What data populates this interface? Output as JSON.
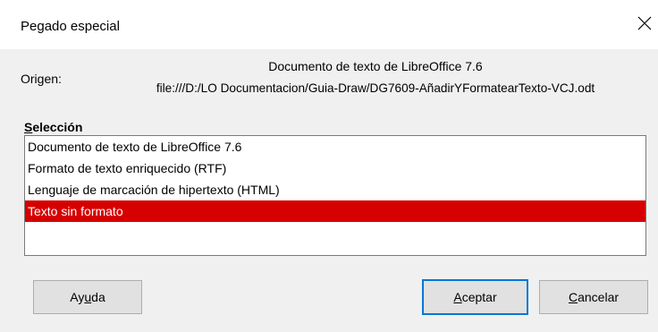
{
  "window": {
    "title": "Pegado especial"
  },
  "origin": {
    "label": "Origen:",
    "name": "Documento de texto de LibreOffice 7.6",
    "path": "file:///D:/LO Documentacion/Guia-Draw/DG7609-AñadirYFormatearTexto-VCJ.odt"
  },
  "selection": {
    "label_mnemonic": "S",
    "label_rest": "elección",
    "items": [
      {
        "label": "Documento de texto de LibreOffice 7.6"
      },
      {
        "label": "Formato de texto enriquecido (RTF)"
      },
      {
        "label": "Lenguaje de marcación de hipertexto (HTML)"
      },
      {
        "label": "Texto sin formato"
      }
    ],
    "selected_index": 3
  },
  "buttons": {
    "help": {
      "pre": "Ay",
      "mnemonic": "u",
      "post": "da"
    },
    "ok": {
      "pre": "",
      "mnemonic": "A",
      "post": "ceptar"
    },
    "cancel": {
      "pre": "",
      "mnemonic": "C",
      "post": "ancelar"
    }
  },
  "colors": {
    "selection_bg": "#d60000",
    "default_button_border": "#0078d7"
  }
}
